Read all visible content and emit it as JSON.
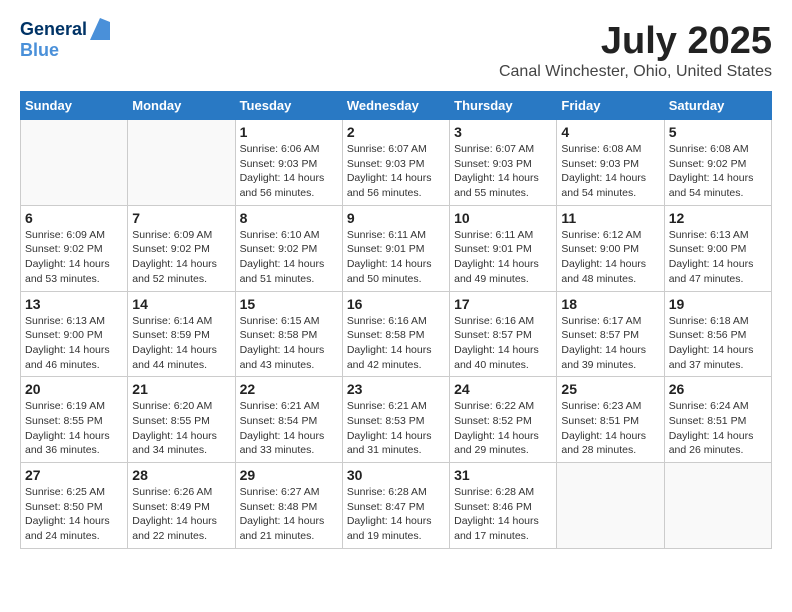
{
  "header": {
    "logo_line1": "General",
    "logo_line2": "Blue",
    "month": "July 2025",
    "location": "Canal Winchester, Ohio, United States"
  },
  "weekdays": [
    "Sunday",
    "Monday",
    "Tuesday",
    "Wednesday",
    "Thursday",
    "Friday",
    "Saturday"
  ],
  "weeks": [
    [
      {
        "day": "",
        "info": ""
      },
      {
        "day": "",
        "info": ""
      },
      {
        "day": "1",
        "info": "Sunrise: 6:06 AM\nSunset: 9:03 PM\nDaylight: 14 hours and 56 minutes."
      },
      {
        "day": "2",
        "info": "Sunrise: 6:07 AM\nSunset: 9:03 PM\nDaylight: 14 hours and 56 minutes."
      },
      {
        "day": "3",
        "info": "Sunrise: 6:07 AM\nSunset: 9:03 PM\nDaylight: 14 hours and 55 minutes."
      },
      {
        "day": "4",
        "info": "Sunrise: 6:08 AM\nSunset: 9:03 PM\nDaylight: 14 hours and 54 minutes."
      },
      {
        "day": "5",
        "info": "Sunrise: 6:08 AM\nSunset: 9:02 PM\nDaylight: 14 hours and 54 minutes."
      }
    ],
    [
      {
        "day": "6",
        "info": "Sunrise: 6:09 AM\nSunset: 9:02 PM\nDaylight: 14 hours and 53 minutes."
      },
      {
        "day": "7",
        "info": "Sunrise: 6:09 AM\nSunset: 9:02 PM\nDaylight: 14 hours and 52 minutes."
      },
      {
        "day": "8",
        "info": "Sunrise: 6:10 AM\nSunset: 9:02 PM\nDaylight: 14 hours and 51 minutes."
      },
      {
        "day": "9",
        "info": "Sunrise: 6:11 AM\nSunset: 9:01 PM\nDaylight: 14 hours and 50 minutes."
      },
      {
        "day": "10",
        "info": "Sunrise: 6:11 AM\nSunset: 9:01 PM\nDaylight: 14 hours and 49 minutes."
      },
      {
        "day": "11",
        "info": "Sunrise: 6:12 AM\nSunset: 9:00 PM\nDaylight: 14 hours and 48 minutes."
      },
      {
        "day": "12",
        "info": "Sunrise: 6:13 AM\nSunset: 9:00 PM\nDaylight: 14 hours and 47 minutes."
      }
    ],
    [
      {
        "day": "13",
        "info": "Sunrise: 6:13 AM\nSunset: 9:00 PM\nDaylight: 14 hours and 46 minutes."
      },
      {
        "day": "14",
        "info": "Sunrise: 6:14 AM\nSunset: 8:59 PM\nDaylight: 14 hours and 44 minutes."
      },
      {
        "day": "15",
        "info": "Sunrise: 6:15 AM\nSunset: 8:58 PM\nDaylight: 14 hours and 43 minutes."
      },
      {
        "day": "16",
        "info": "Sunrise: 6:16 AM\nSunset: 8:58 PM\nDaylight: 14 hours and 42 minutes."
      },
      {
        "day": "17",
        "info": "Sunrise: 6:16 AM\nSunset: 8:57 PM\nDaylight: 14 hours and 40 minutes."
      },
      {
        "day": "18",
        "info": "Sunrise: 6:17 AM\nSunset: 8:57 PM\nDaylight: 14 hours and 39 minutes."
      },
      {
        "day": "19",
        "info": "Sunrise: 6:18 AM\nSunset: 8:56 PM\nDaylight: 14 hours and 37 minutes."
      }
    ],
    [
      {
        "day": "20",
        "info": "Sunrise: 6:19 AM\nSunset: 8:55 PM\nDaylight: 14 hours and 36 minutes."
      },
      {
        "day": "21",
        "info": "Sunrise: 6:20 AM\nSunset: 8:55 PM\nDaylight: 14 hours and 34 minutes."
      },
      {
        "day": "22",
        "info": "Sunrise: 6:21 AM\nSunset: 8:54 PM\nDaylight: 14 hours and 33 minutes."
      },
      {
        "day": "23",
        "info": "Sunrise: 6:21 AM\nSunset: 8:53 PM\nDaylight: 14 hours and 31 minutes."
      },
      {
        "day": "24",
        "info": "Sunrise: 6:22 AM\nSunset: 8:52 PM\nDaylight: 14 hours and 29 minutes."
      },
      {
        "day": "25",
        "info": "Sunrise: 6:23 AM\nSunset: 8:51 PM\nDaylight: 14 hours and 28 minutes."
      },
      {
        "day": "26",
        "info": "Sunrise: 6:24 AM\nSunset: 8:51 PM\nDaylight: 14 hours and 26 minutes."
      }
    ],
    [
      {
        "day": "27",
        "info": "Sunrise: 6:25 AM\nSunset: 8:50 PM\nDaylight: 14 hours and 24 minutes."
      },
      {
        "day": "28",
        "info": "Sunrise: 6:26 AM\nSunset: 8:49 PM\nDaylight: 14 hours and 22 minutes."
      },
      {
        "day": "29",
        "info": "Sunrise: 6:27 AM\nSunset: 8:48 PM\nDaylight: 14 hours and 21 minutes."
      },
      {
        "day": "30",
        "info": "Sunrise: 6:28 AM\nSunset: 8:47 PM\nDaylight: 14 hours and 19 minutes."
      },
      {
        "day": "31",
        "info": "Sunrise: 6:28 AM\nSunset: 8:46 PM\nDaylight: 14 hours and 17 minutes."
      },
      {
        "day": "",
        "info": ""
      },
      {
        "day": "",
        "info": ""
      }
    ]
  ]
}
